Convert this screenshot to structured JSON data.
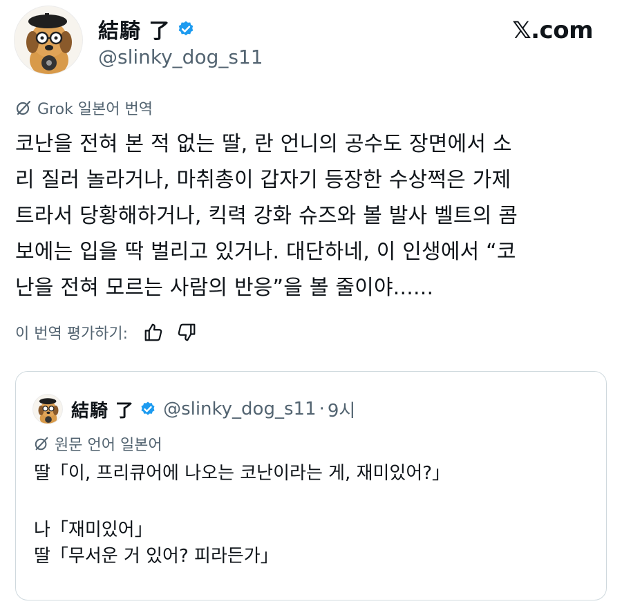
{
  "post": {
    "author_name": "結騎 了",
    "handle": "@slinky_dog_s11",
    "site": "𝕏.com",
    "translation_label": "Grok 일본어 번역",
    "body": "코난을 전혀 본 적 없는 딸, 란 언니의 공수도 장면에서 소\n리 질러 놀라거나, 마취총이 갑자기 등장한 수상쩍은 가제\n트라서 당황해하거나, 킥력 강화 슈즈와 볼 발사 벨트의 콤\n보에는 입을 딱 벌리고 있거나. 대단하네, 이 인생에서 “코\n난을 전혀 모르는 사람의 반응”을 볼 줄이야......",
    "rate_label": "이 번역 평가하기:",
    "like_icon": "thumbs-up-icon",
    "dislike_icon": "thumbs-down-icon"
  },
  "quote": {
    "author_name": "結騎 了",
    "handle": "@slinky_dog_s11",
    "dot": "·",
    "time": "9시",
    "lang_label": "원문 언어 일본어",
    "lines": [
      "딸「이, 프리큐어에 나오는 코난이라는 게, 재미있어?」",
      "",
      "나「재미있어」",
      "딸「무서운 거 있어? 피라든가」"
    ]
  },
  "colors": {
    "verified_blue": "#1d9bf0",
    "secondary_text": "#536471",
    "border": "#cfd9de"
  }
}
